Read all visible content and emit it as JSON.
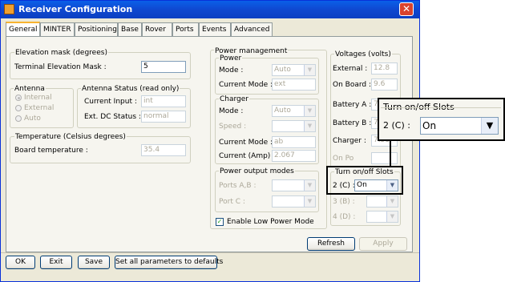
{
  "window": {
    "title": "Receiver Configuration",
    "close": "✕"
  },
  "tabs": [
    "General",
    "MINTER",
    "Positioning",
    "Base",
    "Rover",
    "Ports",
    "Events",
    "Advanced"
  ],
  "elevation": {
    "group": "Elevation mask (degrees)",
    "label": "Terminal Elevation Mask :",
    "value": "5"
  },
  "antenna": {
    "group": "Antenna",
    "options": [
      "Internal",
      "External",
      "Auto"
    ]
  },
  "antenna_status": {
    "group": "Antenna Status (read only)",
    "current_label": "Current Input :",
    "current_value": "int",
    "ext_label": "Ext. DC Status :",
    "ext_value": "normal"
  },
  "temperature": {
    "group": "Temperature (Celsius degrees)",
    "label": "Board temperature :",
    "value": "35.4"
  },
  "power_mgmt": {
    "group": "Power management"
  },
  "power": {
    "group": "Power",
    "mode_label": "Mode :",
    "mode_value": "Auto",
    "current_mode_label": "Current Mode :",
    "current_mode_value": "ext"
  },
  "charger": {
    "group": "Charger",
    "mode_label": "Mode :",
    "mode_value": "Auto",
    "speed_label": "Speed :",
    "speed_value": "",
    "current_mode_label": "Current Mode :",
    "current_mode_value": "ab",
    "current_amp_label": "Current (Amp) :",
    "current_amp_value": "2.067"
  },
  "power_output": {
    "group": "Power output modes",
    "ports_label": "Ports A,B :",
    "portc_label": "Port C :"
  },
  "low_power": {
    "label": "Enable Low Power Mode",
    "checked": true,
    "mark": "✓"
  },
  "voltages": {
    "group": "Voltages (volts)",
    "external_label": "External :",
    "external_value": "12.8",
    "onboard_label": "On Board :",
    "onboard_value": "9.6",
    "batta_label": "Battery A :",
    "batta_value": "7.10",
    "battb_label": "Battery B :",
    "battb_value": "7.16",
    "charger_label": "Charger :",
    "charger_value": "7.58",
    "onpower_label": "On Po"
  },
  "slots": {
    "group": "Turn on/off Slots",
    "slot2_label": "2 (C) :",
    "slot2_value": "On",
    "slot3_label": "3 (B) :",
    "slot4_label": "4 (D) :"
  },
  "callout": {
    "group": "Turn on/off Slots",
    "label": "2 (C) :",
    "value": "On"
  },
  "panel_buttons": {
    "refresh": "Refresh",
    "apply": "Apply"
  },
  "bottom_buttons": {
    "ok": "OK",
    "exit": "Exit",
    "save": "Save",
    "defaults": "Set all parameters to defaults"
  },
  "arrow": "▼"
}
